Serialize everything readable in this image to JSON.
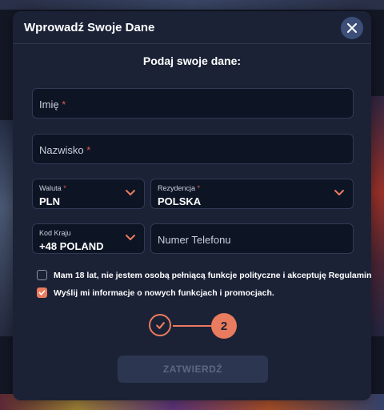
{
  "modal": {
    "title": "Wprowadź Swoje Dane",
    "close_icon": "close-icon",
    "subtitle": "Podaj swoje dane:"
  },
  "form": {
    "first_name": {
      "placeholder": "Imię",
      "required_mark": "*"
    },
    "last_name": {
      "placeholder": "Nazwisko",
      "required_mark": "*"
    },
    "currency": {
      "label": "Waluta",
      "required_mark": "*",
      "value": "PLN"
    },
    "residence": {
      "label": "Rezydencja",
      "required_mark": "*",
      "value": "POLSKA"
    },
    "country_code": {
      "label": "Kod Kraju",
      "value": "+48 POLAND"
    },
    "phone": {
      "placeholder": "Numer Telefonu"
    },
    "terms_checkbox": {
      "label": "Mam 18 lat, nie jestem osobą pełniącą funkcje polityczne i akceptuję Regulamin",
      "checked": false
    },
    "promo_checkbox": {
      "label": "Wyślij mi informacje o nowych funkcjach i promocjach.",
      "checked": true
    }
  },
  "stepper": {
    "current_step": "2",
    "completed_icon": "checkmark-icon"
  },
  "submit": {
    "label": "ZATWIERDŹ",
    "enabled": false
  },
  "colors": {
    "accent": "#e97b5e",
    "modal_bg": "#1b2236",
    "field_bg": "#0d1424",
    "required": "#e05a4a"
  }
}
